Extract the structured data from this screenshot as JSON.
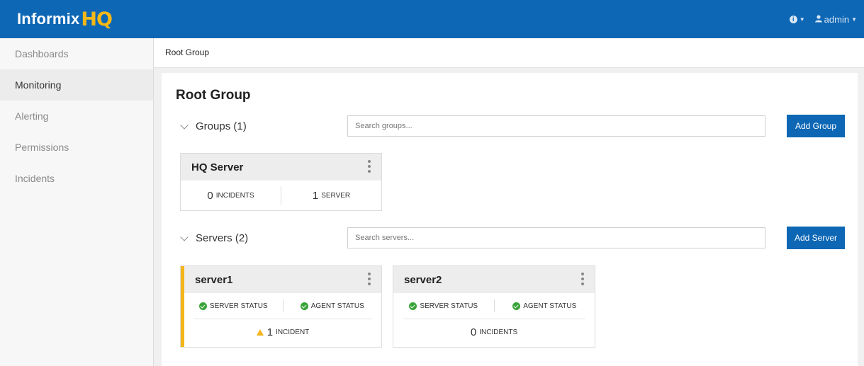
{
  "header": {
    "logo_text": "Informix",
    "logo_accent": "HQ",
    "info_icon": "info-circle-icon",
    "user_label": "admin"
  },
  "sidebar": {
    "items": [
      {
        "label": "Dashboards",
        "active": false
      },
      {
        "label": "Monitoring",
        "active": true
      },
      {
        "label": "Alerting",
        "active": false
      },
      {
        "label": "Permissions",
        "active": false
      },
      {
        "label": "Incidents",
        "active": false
      }
    ]
  },
  "breadcrumb": "Root Group",
  "main": {
    "title": "Root Group",
    "groups_section": {
      "label": "Groups (1)",
      "search_placeholder": "Search groups...",
      "add_label": "Add Group"
    },
    "servers_section": {
      "label": "Servers (2)",
      "search_placeholder": "Search servers...",
      "add_label": "Add Server"
    },
    "groups": [
      {
        "name": "HQ Server",
        "incidents_count": "0",
        "incidents_label": "INCIDENTS",
        "servers_count": "1",
        "servers_label": "SERVER"
      }
    ],
    "servers": [
      {
        "name": "server1",
        "server_status_label": "SERVER STATUS",
        "agent_status_label": "AGENT STATUS",
        "incident_count": "1",
        "incident_label": "INCIDENT",
        "has_warning": true
      },
      {
        "name": "server2",
        "server_status_label": "SERVER STATUS",
        "agent_status_label": "AGENT STATUS",
        "incident_count": "0",
        "incident_label": "INCIDENTS",
        "has_warning": false
      }
    ]
  },
  "colors": {
    "brand_blue": "#0d67b5",
    "accent_yellow": "#f4b51b",
    "status_green": "#3aa43a"
  }
}
